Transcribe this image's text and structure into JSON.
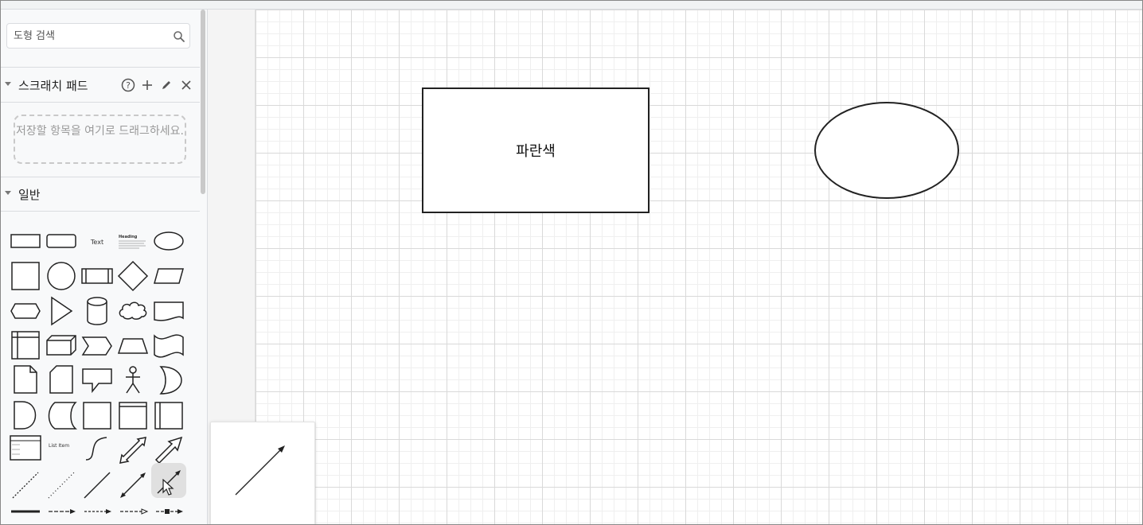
{
  "search": {
    "placeholder": "도형 검색"
  },
  "scratchpad": {
    "title": "스크래치 패드",
    "help_icon": "help-circle-icon",
    "add_icon": "plus-icon",
    "edit_icon": "pencil-icon",
    "close_icon": "close-icon",
    "dropzone_text": "저장할 항목을 여기로 드래그하세요."
  },
  "general": {
    "title": "일반",
    "shape_labels": {
      "text": "Text",
      "heading": "Heading",
      "list_item": "List Item"
    }
  },
  "canvas": {
    "rect_label": "파란색"
  },
  "colors": {
    "accent": "#1a73e8",
    "stroke": "#222222",
    "grid": "#d9d9d9"
  }
}
